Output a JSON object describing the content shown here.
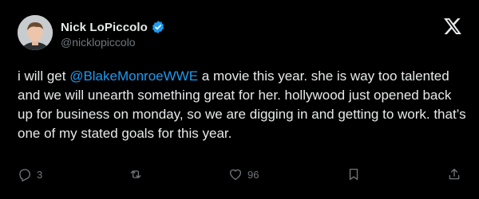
{
  "author": {
    "display_name": "Nick LoPiccolo",
    "handle": "@nicklopiccolo",
    "verified": true
  },
  "tweet": {
    "text_before": "i will get ",
    "mention": "@BlakeMonroeWWE",
    "text_after": " a movie this year. she is way too talented and we will unearth something great for her. hollywood just opened back up for business on monday, so we are digging in and getting to work. that’s one of my stated goals for this year."
  },
  "actions": {
    "reply_count": "3",
    "retweet_count": "",
    "like_count": "96"
  },
  "icons": {
    "brand": "x-logo-icon",
    "verified": "verified-badge-icon",
    "reply": "reply-icon",
    "retweet": "retweet-icon",
    "like": "heart-icon",
    "bookmark": "bookmark-icon",
    "share": "share-icon"
  },
  "colors": {
    "background": "#000000",
    "text": "#e7e9ea",
    "muted": "#71767b",
    "accent": "#1d9bf0"
  }
}
